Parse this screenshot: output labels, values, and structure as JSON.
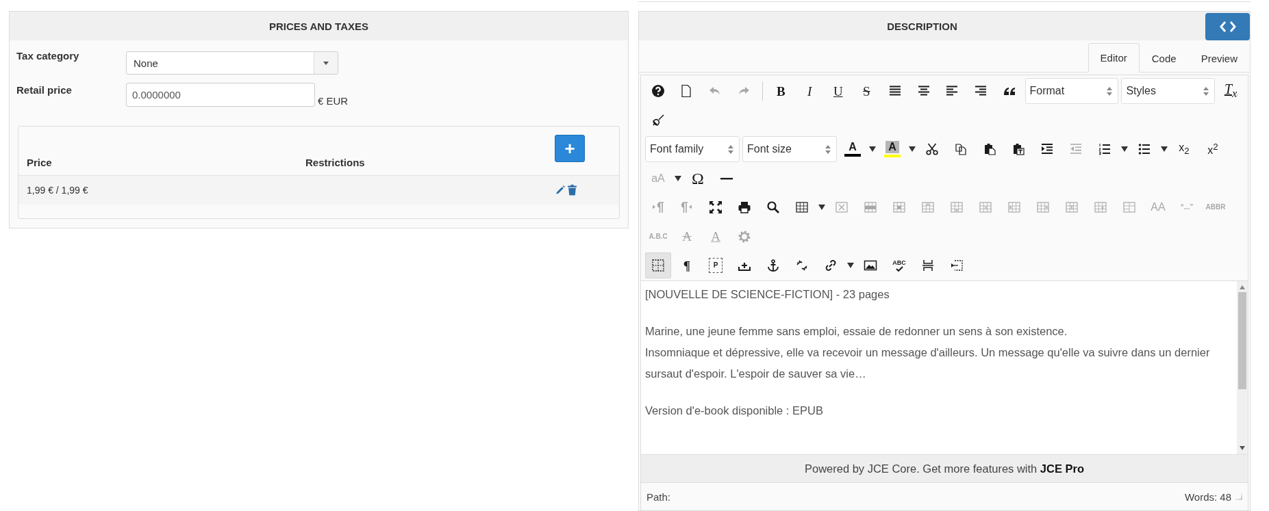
{
  "prices_panel": {
    "title": "PRICES AND TAXES",
    "tax_category": {
      "label": "Tax category",
      "value": "None"
    },
    "retail_price": {
      "label": "Retail price",
      "value": "0.0000000",
      "unit": "€ EUR"
    },
    "price_table": {
      "columns": [
        "Price",
        "Restrictions"
      ],
      "add_button": "+",
      "rows": [
        {
          "price": "1,99 € / 1,99 €"
        }
      ]
    }
  },
  "description_panel": {
    "title": "DESCRIPTION",
    "tabs": [
      {
        "label": "Editor",
        "selected": true
      },
      {
        "label": "Code",
        "selected": false
      },
      {
        "label": "Preview",
        "selected": false
      }
    ],
    "toolbar": [
      [
        {
          "kind": "icon",
          "disabled": false,
          "active": false
        },
        {
          "kind": "icon",
          "disabled": false,
          "active": false
        },
        {
          "kind": "icon",
          "disabled": true,
          "active": false
        },
        {
          "kind": "icon",
          "disabled": true,
          "active": false
        },
        {
          "kind": "separator"
        },
        {
          "kind": "glyph",
          "text": "B",
          "disabled": false
        },
        {
          "kind": "glyph",
          "text": "I",
          "disabled": false
        },
        {
          "kind": "glyph",
          "text": "U",
          "disabled": false
        },
        {
          "kind": "glyph",
          "text": "S",
          "disabled": false
        },
        {
          "kind": "icon",
          "disabled": false,
          "active": false
        },
        {
          "kind": "icon",
          "disabled": false,
          "active": false
        },
        {
          "kind": "icon",
          "disabled": false,
          "active": false
        },
        {
          "kind": "icon",
          "disabled": false,
          "active": false
        },
        {
          "kind": "icon",
          "disabled": false,
          "active": false
        },
        {
          "kind": "select",
          "value": "Format"
        },
        {
          "kind": "select",
          "value": "Styles"
        },
        {
          "kind": "glyph",
          "text": "T$_{x}$",
          "disabled": false
        }
      ],
      [
        {
          "kind": "icon",
          "disabled": false,
          "active": false
        }
      ],
      [
        {
          "kind": "select",
          "value": "Font family"
        },
        {
          "kind": "select",
          "value": "Font size"
        },
        {
          "kind": "glyph",
          "text": "A",
          "color": "#000000",
          "disabled": false
        },
        {
          "kind": "arrow",
          "disabled": false
        },
        {
          "kind": "glyph",
          "text": "A",
          "color": "#ffff00",
          "disabled": false
        },
        {
          "kind": "arrow",
          "disabled": false
        },
        {
          "kind": "icon",
          "disabled": false,
          "active": false
        },
        {
          "kind": "icon",
          "disabled": false,
          "active": false
        },
        {
          "kind": "icon",
          "disabled": false,
          "active": false
        },
        {
          "kind": "icon",
          "disabled": false,
          "active": false
        },
        {
          "kind": "icon",
          "disabled": false,
          "active": false
        },
        {
          "kind": "icon",
          "disabled": true,
          "active": false
        },
        {
          "kind": "icon",
          "disabled": false,
          "active": false
        },
        {
          "kind": "arrow",
          "disabled": false
        },
        {
          "kind": "icon",
          "disabled": false,
          "active": false
        },
        {
          "kind": "arrow",
          "disabled": false
        },
        {
          "kind": "glyph",
          "text": "x$_{2}$",
          "disabled": false
        },
        {
          "kind": "glyph",
          "text": "x$^{2}$",
          "disabled": false
        }
      ],
      [
        {
          "kind": "glyph",
          "text": "aA",
          "disabled": true
        },
        {
          "kind": "arrow",
          "disabled": false
        },
        {
          "kind": "glyph",
          "text": "Ω",
          "disabled": false
        },
        {
          "kind": "icon",
          "disabled": false,
          "active": false
        }
      ],
      [
        {
          "kind": "icon",
          "disabled": true,
          "active": false
        },
        {
          "kind": "icon",
          "disabled": true,
          "active": false
        },
        {
          "kind": "icon",
          "disabled": false,
          "active": false
        },
        {
          "kind": "icon",
          "disabled": false,
          "active": false
        },
        {
          "kind": "icon",
          "disabled": false,
          "active": false
        },
        {
          "kind": "icon",
          "disabled": false,
          "active": false
        },
        {
          "kind": "arrow",
          "disabled": false
        },
        {
          "kind": "icon",
          "disabled": true,
          "active": false
        },
        {
          "kind": "icon",
          "disabled": true,
          "active": false
        },
        {
          "kind": "icon",
          "disabled": true,
          "active": false
        },
        {
          "kind": "icon",
          "disabled": true,
          "active": false
        },
        {
          "kind": "icon",
          "disabled": true,
          "active": false
        },
        {
          "kind": "icon",
          "disabled": true,
          "active": false
        },
        {
          "kind": "icon",
          "disabled": true,
          "active": false
        },
        {
          "kind": "icon",
          "disabled": true,
          "active": false
        },
        {
          "kind": "icon",
          "disabled": true,
          "active": false
        },
        {
          "kind": "icon",
          "disabled": true,
          "active": false
        },
        {
          "kind": "icon",
          "disabled": true,
          "active": false
        },
        {
          "kind": "glyph",
          "text": "AA",
          "disabled": true
        },
        {
          "kind": "glyph",
          "text": "“...”",
          "disabled": true
        },
        {
          "kind": "glyph",
          "text": "ABBR",
          "disabled": true
        }
      ],
      [
        {
          "kind": "glyph",
          "text": "A.B.C",
          "disabled": true
        },
        {
          "kind": "glyph",
          "text": "A",
          "disabled": true
        },
        {
          "kind": "glyph",
          "text": "A",
          "disabled": true
        },
        {
          "kind": "icon",
          "disabled": true,
          "active": false
        }
      ],
      [
        {
          "kind": "icon",
          "disabled": false,
          "active": true
        },
        {
          "kind": "glyph",
          "text": "¶",
          "disabled": false
        },
        {
          "kind": "glyph",
          "text": "P",
          "disabled": false
        },
        {
          "kind": "icon",
          "disabled": false,
          "active": false
        },
        {
          "kind": "icon",
          "disabled": false,
          "active": false
        },
        {
          "kind": "icon",
          "disabled": false,
          "active": false
        },
        {
          "kind": "icon",
          "disabled": false,
          "active": false
        },
        {
          "kind": "arrow",
          "disabled": false
        },
        {
          "kind": "icon",
          "disabled": false,
          "active": false
        },
        {
          "kind": "glyph",
          "text": "ABC",
          "disabled": false
        },
        {
          "kind": "icon",
          "disabled": false,
          "active": false
        },
        {
          "kind": "icon",
          "disabled": false,
          "active": false
        }
      ]
    ],
    "content": [
      [
        "[NOUVELLE DE SCIENCE-FICTION] - 23 pages"
      ],
      [
        "Marine, une jeune femme sans emploi, essaie de redonner un sens à son existence.",
        "Insomniaque et dépressive, elle va recevoir un message d'ailleurs. Un message qu'elle va suivre dans un dernier sursaut d'espoir. L'espoir de sauver sa vie…"
      ],
      [
        "Version d'e-book disponible  : EPUB"
      ]
    ],
    "footer": "Powered by JCE Core. Get more features with **JCE Pro**",
    "path_label": "Path:",
    "word_count": "Words: 48"
  }
}
